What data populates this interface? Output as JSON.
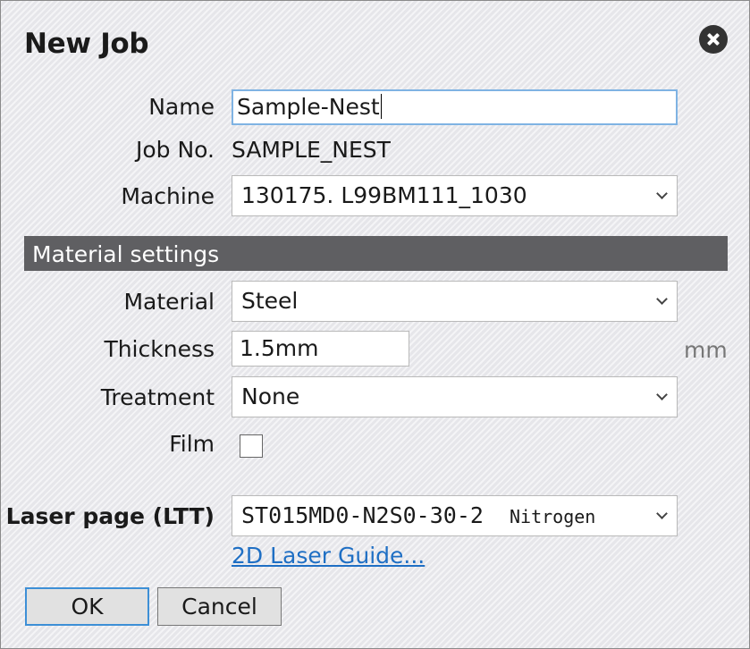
{
  "dialog": {
    "title": "New Job"
  },
  "form": {
    "name_label": "Name",
    "name_value": "Sample-Nest",
    "jobno_label": "Job No.",
    "jobno_value": "SAMPLE_NEST",
    "machine_label": "Machine",
    "machine_value": "130175. L99BM111_1030"
  },
  "material_section": {
    "header": "Material settings",
    "material_label": "Material",
    "material_value": "Steel",
    "thickness_label": "Thickness",
    "thickness_value": "1.5mm",
    "thickness_unit": "mm",
    "treatment_label": "Treatment",
    "treatment_value": "None",
    "film_label": "Film",
    "film_checked": false
  },
  "laser": {
    "label": "Laser page (LTT)",
    "code": "ST015MD0-N2S0-30-2",
    "gas": "Nitrogen",
    "guide_link": "2D Laser Guide..."
  },
  "buttons": {
    "ok": "OK",
    "cancel": "Cancel"
  },
  "colors": {
    "section_bg": "#5f5f62",
    "focus_border": "#7fb3e3",
    "link": "#1f6fc4"
  }
}
